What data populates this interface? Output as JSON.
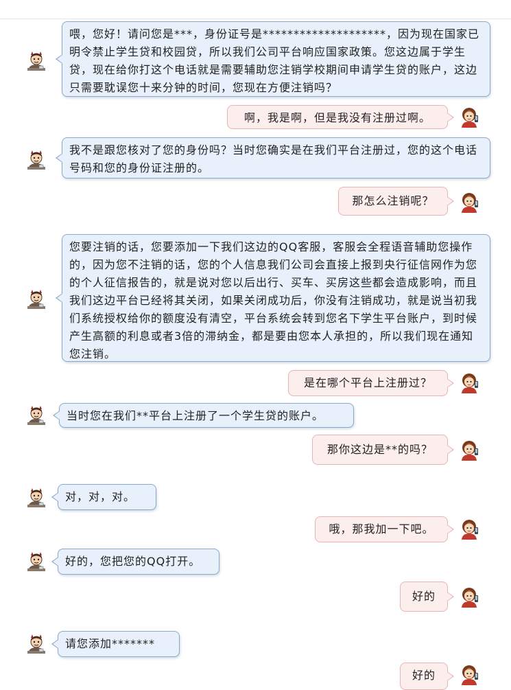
{
  "conversation": {
    "messages": [
      {
        "side": "left",
        "avatar_icon": "scammer-devil-avatar-icon",
        "text": "喂，您好！请问您是***，身份证号是********************，因为现在国家已明令禁止学生贷和校园贷，所以我们公司平台响应国家政策。您这边属于学生贷，现在给你打这个电话就是需要辅助您注销学校期间申请学生贷的账户，这边只需要耽误您十来分钟的时间，您现在方便注销吗？"
      },
      {
        "side": "right",
        "avatar_icon": "student-girl-avatar-icon",
        "text": "啊，我是啊，但是我没有注册过啊。"
      },
      {
        "side": "left",
        "avatar_icon": "scammer-devil-avatar-icon",
        "text": "我不是跟您核对了您的身份吗？当时您确实是在我们平台注册过，您的这个电话号码和您的身份证注册的。"
      },
      {
        "side": "right",
        "avatar_icon": "student-girl-avatar-icon",
        "text": "那怎么注销呢？"
      },
      {
        "side": "left",
        "avatar_icon": "scammer-devil-avatar-icon",
        "text": "您要注销的话，您要添加一下我们这边的QQ客服，客服会全程语音辅助您操作的，因为您不注销的话，您的个人信息我们公司会直接上报到央行征信网作为您的个人征信报告的，就是说对您以后出行、买车、买房这些都会造成影响，而且我们这边平台已经将其关闭，如果关闭成功后，你没有注销成功，就是说当初我们系统授权给你的额度没有清空，平台系统会转到您名下学生平台账户，到时候产生高额的利息或者3倍的滞纳金，都是要由您本人承担的，所以我们现在通知您注销。"
      },
      {
        "side": "right",
        "avatar_icon": "student-girl-avatar-icon",
        "text": "是在哪个平台上注册过？"
      },
      {
        "side": "left",
        "avatar_icon": "scammer-devil-avatar-icon",
        "text": "当时您在我们**平台上注册了一个学生贷的账户。"
      },
      {
        "side": "right",
        "avatar_icon": "student-girl-avatar-icon",
        "text": "那你这边是**的吗？"
      },
      {
        "side": "left",
        "avatar_icon": "scammer-devil-avatar-icon",
        "text": "对，对，对。"
      },
      {
        "side": "right",
        "avatar_icon": "student-girl-avatar-icon",
        "text": "哦，那我加一下吧。"
      },
      {
        "side": "left",
        "avatar_icon": "scammer-devil-avatar-icon",
        "text": "好的，您把您的QQ打开。"
      },
      {
        "side": "right",
        "avatar_icon": "student-girl-avatar-icon",
        "text": "好的"
      },
      {
        "side": "left",
        "avatar_icon": "scammer-devil-avatar-icon",
        "text": "请您添加*******"
      },
      {
        "side": "right",
        "avatar_icon": "student-girl-avatar-icon",
        "text": "好的"
      }
    ]
  },
  "colors": {
    "left_bubble_bg": "#e8f1fb",
    "left_bubble_border": "#8ba7c9",
    "right_bubble_bg": "#fdeeee",
    "right_bubble_border": "#e8b3b3"
  }
}
